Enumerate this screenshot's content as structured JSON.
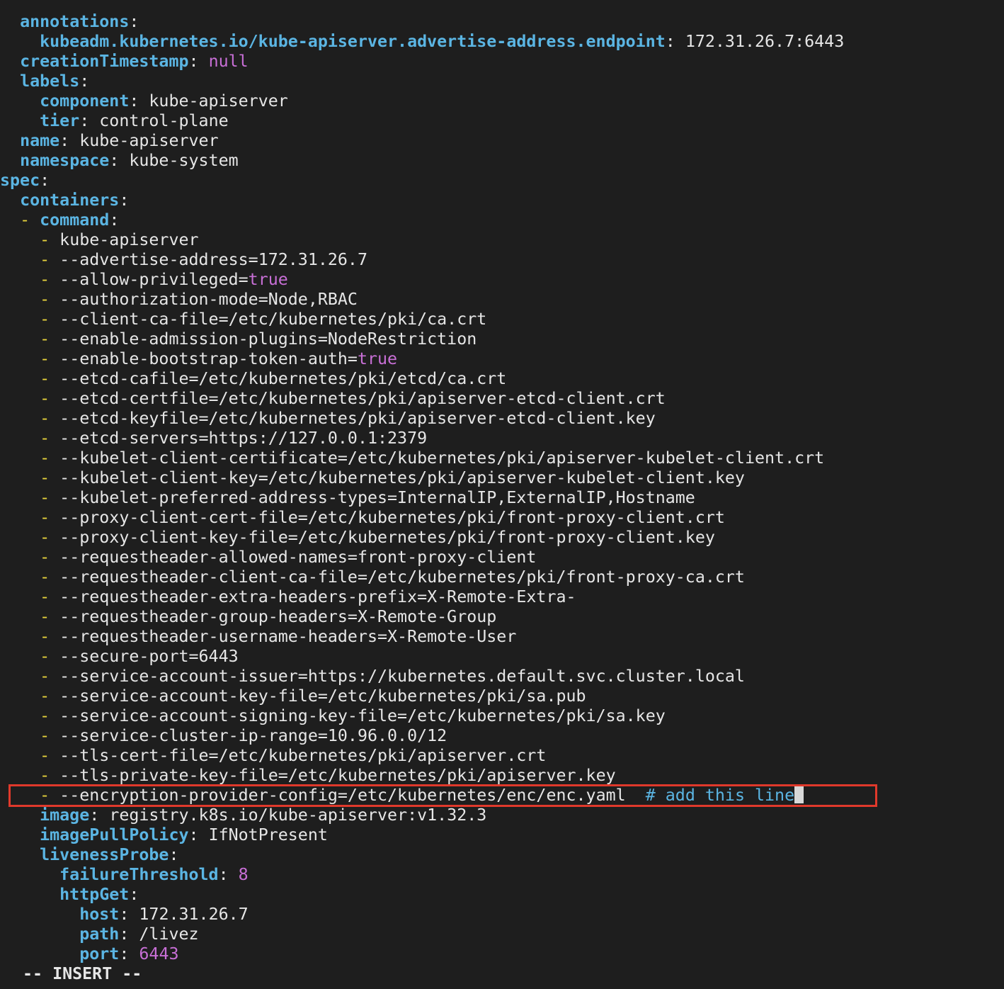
{
  "editor": {
    "lines": [
      {
        "indent": "  ",
        "key": "annotations"
      },
      {
        "indent": "    ",
        "key": "kubeadm.kubernetes.io/kube-apiserver.advertise-address.endpoint",
        "value": "172.31.26.7:6443"
      },
      {
        "indent": "  ",
        "key": "creationTimestamp",
        "value": "null",
        "value_type": "bool"
      },
      {
        "indent": "  ",
        "key": "labels"
      },
      {
        "indent": "    ",
        "key": "component",
        "value": "kube-apiserver"
      },
      {
        "indent": "    ",
        "key": "tier",
        "value": "control-plane"
      },
      {
        "indent": "  ",
        "key": "name",
        "value": "kube-apiserver"
      },
      {
        "indent": "  ",
        "key": "namespace",
        "value": "kube-system"
      },
      {
        "indent": "",
        "key": "spec"
      },
      {
        "indent": "  ",
        "key": "containers"
      },
      {
        "indent": "  ",
        "dash": true,
        "key": "command"
      },
      {
        "indent": "    ",
        "dash": true,
        "value": "kube-apiserver"
      },
      {
        "indent": "    ",
        "dash": true,
        "value": "--advertise-address=172.31.26.7"
      },
      {
        "indent": "    ",
        "dash": true,
        "value": "--allow-privileged=",
        "tail": "true"
      },
      {
        "indent": "    ",
        "dash": true,
        "value": "--authorization-mode=Node,RBAC"
      },
      {
        "indent": "    ",
        "dash": true,
        "value": "--client-ca-file=/etc/kubernetes/pki/ca.crt"
      },
      {
        "indent": "    ",
        "dash": true,
        "value": "--enable-admission-plugins=NodeRestriction"
      },
      {
        "indent": "    ",
        "dash": true,
        "value": "--enable-bootstrap-token-auth=",
        "tail": "true"
      },
      {
        "indent": "    ",
        "dash": true,
        "value": "--etcd-cafile=/etc/kubernetes/pki/etcd/ca.crt"
      },
      {
        "indent": "    ",
        "dash": true,
        "value": "--etcd-certfile=/etc/kubernetes/pki/apiserver-etcd-client.crt"
      },
      {
        "indent": "    ",
        "dash": true,
        "value": "--etcd-keyfile=/etc/kubernetes/pki/apiserver-etcd-client.key"
      },
      {
        "indent": "    ",
        "dash": true,
        "value": "--etcd-servers=https://127.0.0.1:2379"
      },
      {
        "indent": "    ",
        "dash": true,
        "value": "--kubelet-client-certificate=/etc/kubernetes/pki/apiserver-kubelet-client.crt"
      },
      {
        "indent": "    ",
        "dash": true,
        "value": "--kubelet-client-key=/etc/kubernetes/pki/apiserver-kubelet-client.key"
      },
      {
        "indent": "    ",
        "dash": true,
        "value": "--kubelet-preferred-address-types=InternalIP,ExternalIP,Hostname"
      },
      {
        "indent": "    ",
        "dash": true,
        "value": "--proxy-client-cert-file=/etc/kubernetes/pki/front-proxy-client.crt"
      },
      {
        "indent": "    ",
        "dash": true,
        "value": "--proxy-client-key-file=/etc/kubernetes/pki/front-proxy-client.key"
      },
      {
        "indent": "    ",
        "dash": true,
        "value": "--requestheader-allowed-names=front-proxy-client"
      },
      {
        "indent": "    ",
        "dash": true,
        "value": "--requestheader-client-ca-file=/etc/kubernetes/pki/front-proxy-ca.crt"
      },
      {
        "indent": "    ",
        "dash": true,
        "value": "--requestheader-extra-headers-prefix=X-Remote-Extra-"
      },
      {
        "indent": "    ",
        "dash": true,
        "value": "--requestheader-group-headers=X-Remote-Group"
      },
      {
        "indent": "    ",
        "dash": true,
        "value": "--requestheader-username-headers=X-Remote-User"
      },
      {
        "indent": "    ",
        "dash": true,
        "value": "--secure-port=6443"
      },
      {
        "indent": "    ",
        "dash": true,
        "value": "--service-account-issuer=https://kubernetes.default.svc.cluster.local"
      },
      {
        "indent": "    ",
        "dash": true,
        "value": "--service-account-key-file=/etc/kubernetes/pki/sa.pub"
      },
      {
        "indent": "    ",
        "dash": true,
        "value": "--service-account-signing-key-file=/etc/kubernetes/pki/sa.key"
      },
      {
        "indent": "    ",
        "dash": true,
        "value": "--service-cluster-ip-range=10.96.0.0/12"
      },
      {
        "indent": "    ",
        "dash": true,
        "value": "--tls-cert-file=/etc/kubernetes/pki/apiserver.crt"
      },
      {
        "indent": "    ",
        "dash": true,
        "value": "--tls-private-key-file=/etc/kubernetes/pki/apiserver.key"
      },
      {
        "indent": "    ",
        "dash": true,
        "value": "--encryption-provider-config=/etc/kubernetes/enc/enc.yaml",
        "comment": "# add this line",
        "cursor": true,
        "highlighted": true
      },
      {
        "indent": "    ",
        "key": "image",
        "value": "registry.k8s.io/kube-apiserver:v1.32.3"
      },
      {
        "indent": "    ",
        "key": "imagePullPolicy",
        "value": "IfNotPresent"
      },
      {
        "indent": "    ",
        "key": "livenessProbe"
      },
      {
        "indent": "      ",
        "key": "failureThreshold",
        "value": "8",
        "value_type": "num"
      },
      {
        "indent": "      ",
        "key": "httpGet"
      },
      {
        "indent": "        ",
        "key": "host",
        "value": "172.31.26.7"
      },
      {
        "indent": "        ",
        "key": "path",
        "value": "/livez"
      },
      {
        "indent": "        ",
        "key": "port",
        "value": "6443",
        "value_type": "num"
      }
    ]
  },
  "status": {
    "mode": "-- INSERT --"
  },
  "colors": {
    "background": "#1e1e1e",
    "key": "#5bb5e3",
    "dash": "#e6d23c",
    "literal": "#c86fd6",
    "text": "#e6e6e6",
    "highlight_border": "#e0392b"
  }
}
